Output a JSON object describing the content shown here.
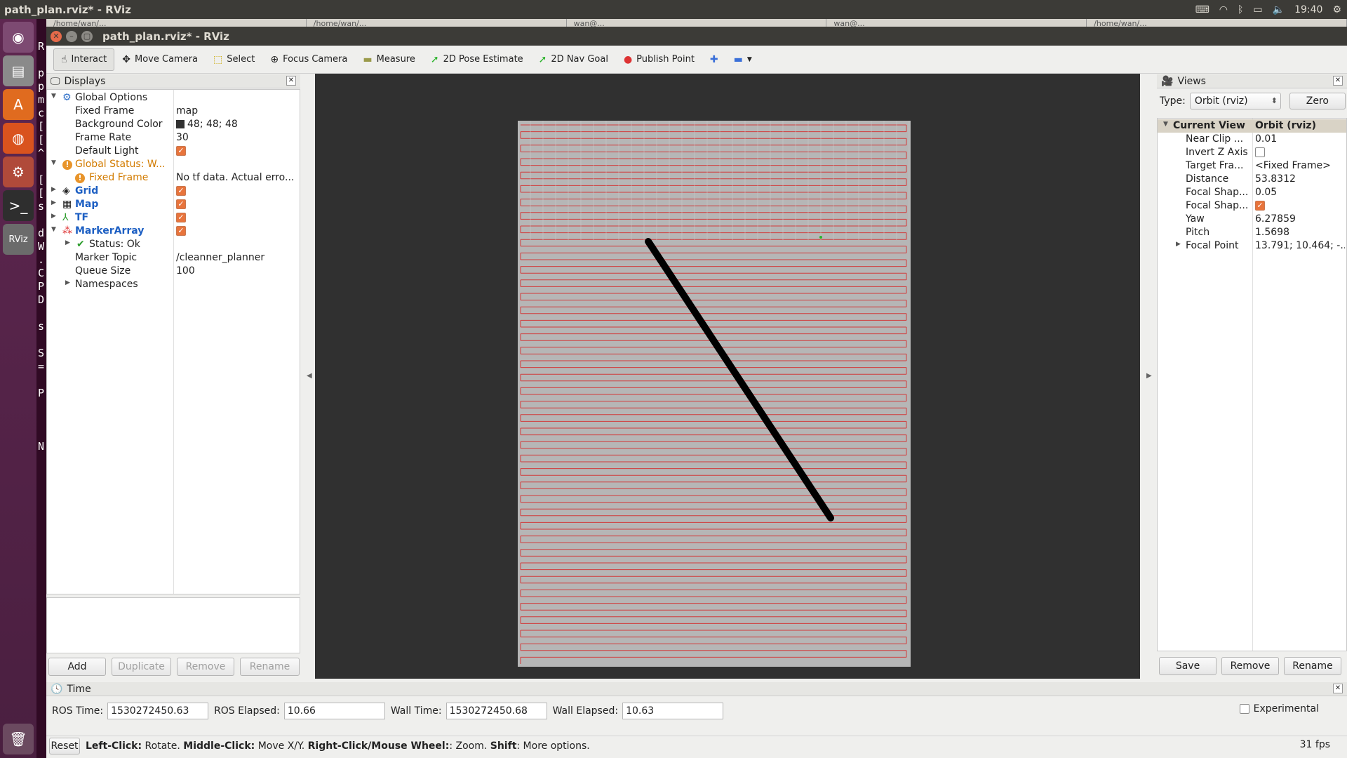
{
  "system": {
    "window_title": "path_plan.rviz* - RViz",
    "clock": "19:40"
  },
  "bg_terminal_lines": [
    "R",
    "",
    "p",
    "p",
    "m",
    "c",
    "[",
    "[",
    "^",
    "",
    "[",
    "[",
    "s",
    "",
    "d",
    "W",
    ".",
    "C",
    "P",
    "D",
    "",
    "s",
    "",
    "S",
    "=",
    "",
    "P",
    "",
    "",
    "",
    "N"
  ],
  "bg_tabs": [
    "/home/wan/... ",
    "/home/wan/... ",
    "wan@...",
    "wan@...",
    "/home/wan/... "
  ],
  "window": {
    "title": "path_plan.rviz* - RViz"
  },
  "toolbar": {
    "tools": [
      {
        "label": "Interact",
        "icon": "☝",
        "name": "interact-tool",
        "active": true
      },
      {
        "label": "Move Camera",
        "icon": "✥",
        "name": "move-camera-tool"
      },
      {
        "label": "Select",
        "icon": "⬚",
        "name": "select-tool"
      },
      {
        "label": "Focus Camera",
        "icon": "⊕",
        "name": "focus-camera-tool"
      },
      {
        "label": "Measure",
        "icon": "▬",
        "name": "measure-tool"
      },
      {
        "label": "2D Pose Estimate",
        "icon": "➚",
        "name": "2d-pose-estimate-tool"
      },
      {
        "label": "2D Nav Goal",
        "icon": "➚",
        "name": "2d-nav-goal-tool"
      },
      {
        "label": "Publish Point",
        "icon": "📍",
        "name": "publish-point-tool"
      }
    ]
  },
  "displays": {
    "header": "Displays",
    "global_options": "Global Options",
    "fixed_frame_label": "Fixed Frame",
    "fixed_frame_value": "map",
    "bg_color_label": "Background Color",
    "bg_color_value": "48; 48; 48",
    "frame_rate_label": "Frame Rate",
    "frame_rate_value": "30",
    "default_light_label": "Default Light",
    "global_status_label": "Global Status: W...",
    "fixed_frame_warn_label": "Fixed Frame",
    "fixed_frame_warn_value": "No tf data.  Actual erro...",
    "grid": "Grid",
    "map": "Map",
    "tf": "TF",
    "marker_array": "MarkerArray",
    "status_ok": "Status: Ok",
    "marker_topic_label": "Marker Topic",
    "marker_topic_value": "/cleanner_planner",
    "queue_size_label": "Queue Size",
    "queue_size_value": "100",
    "namespaces": "Namespaces",
    "buttons": {
      "add": "Add",
      "duplicate": "Duplicate",
      "remove": "Remove",
      "rename": "Rename"
    }
  },
  "views": {
    "header": "Views",
    "type_label": "Type:",
    "type_value": "Orbit (rviz)",
    "zero": "Zero",
    "current_view": "Current View",
    "current_view_type": "Orbit (rviz)",
    "rows": [
      {
        "k": "Near Clip ...",
        "v": "0.01"
      },
      {
        "k": "Invert Z Axis",
        "v": ""
      },
      {
        "k": "Target Fra...",
        "v": "<Fixed Frame>"
      },
      {
        "k": "Distance",
        "v": "53.8312"
      },
      {
        "k": "Focal Shap...",
        "v": "0.05"
      },
      {
        "k": "Focal Shap...",
        "v": ""
      },
      {
        "k": "Yaw",
        "v": "6.27859"
      },
      {
        "k": "Pitch",
        "v": "1.5698"
      },
      {
        "k": "Focal Point",
        "v": "13.791; 10.464; -..."
      }
    ],
    "buttons": {
      "save": "Save",
      "remove": "Remove",
      "rename": "Rename"
    }
  },
  "time": {
    "header": "Time",
    "ros_time_label": "ROS Time:",
    "ros_time": "1530272450.63",
    "ros_elapsed_label": "ROS Elapsed:",
    "ros_elapsed": "10.66",
    "wall_time_label": "Wall Time:",
    "wall_time": "1530272450.68",
    "wall_elapsed_label": "Wall Elapsed:",
    "wall_elapsed": "10.63",
    "experimental": "Experimental"
  },
  "statusbar": {
    "reset": "Reset",
    "hint_b1": "Left-Click:",
    "hint_t1": " Rotate. ",
    "hint_b2": "Middle-Click:",
    "hint_t2": " Move X/Y. ",
    "hint_b3": "Right-Click/Mouse Wheel:",
    "hint_t3": ": Zoom. ",
    "hint_b4": "Shift",
    "hint_t4": ": More options.",
    "fps": "31 fps"
  },
  "colors": {
    "render_bg": "#303030",
    "map_gray": "#b6b6b6",
    "path_red": "#d13a3a",
    "obstacle": "#000000",
    "launcher": "#5e2750"
  }
}
